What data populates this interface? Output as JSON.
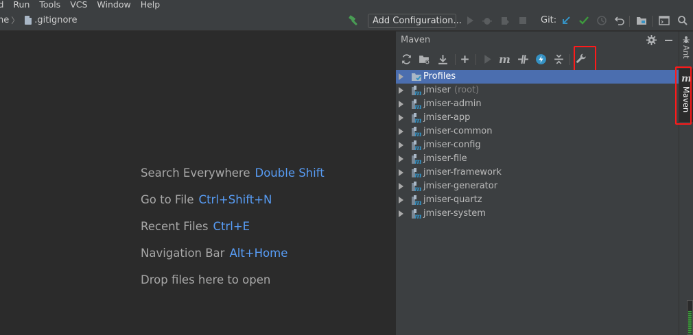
{
  "menu": {
    "items": [
      "ld",
      "Run",
      "Tools",
      "VCS",
      "Window",
      "Help"
    ]
  },
  "breadcrumb": {
    "parent": "ne",
    "file": ".gitignore"
  },
  "toolbar": {
    "add_configuration": "Add Configuration...",
    "git_label": "Git:"
  },
  "editor": {
    "hints": [
      {
        "text": "Search Everywhere",
        "key": "Double Shift"
      },
      {
        "text": "Go to File",
        "key": "Ctrl+Shift+N"
      },
      {
        "text": "Recent Files",
        "key": "Ctrl+E"
      },
      {
        "text": "Navigation Bar",
        "key": "Alt+Home"
      },
      {
        "text": "Drop files here to open",
        "key": ""
      }
    ]
  },
  "maven": {
    "title": "Maven",
    "tree": [
      {
        "label": "Profiles",
        "note": "",
        "icon": "profiles-icon",
        "selected": true
      },
      {
        "label": "jmiser",
        "note": "(root)",
        "icon": "maven-module-icon",
        "selected": false
      },
      {
        "label": "jmiser-admin",
        "note": "",
        "icon": "maven-module-icon",
        "selected": false
      },
      {
        "label": "jmiser-app",
        "note": "",
        "icon": "maven-module-icon",
        "selected": false
      },
      {
        "label": "jmiser-common",
        "note": "",
        "icon": "maven-module-icon",
        "selected": false
      },
      {
        "label": "jmiser-config",
        "note": "",
        "icon": "maven-module-icon",
        "selected": false
      },
      {
        "label": "jmiser-file",
        "note": "",
        "icon": "maven-module-icon",
        "selected": false
      },
      {
        "label": "jmiser-framework",
        "note": "",
        "icon": "maven-module-icon",
        "selected": false
      },
      {
        "label": "jmiser-generator",
        "note": "",
        "icon": "maven-module-icon",
        "selected": false
      },
      {
        "label": "jmiser-quartz",
        "note": "",
        "icon": "maven-module-icon",
        "selected": false
      },
      {
        "label": "jmiser-system",
        "note": "",
        "icon": "maven-module-icon",
        "selected": false
      }
    ]
  },
  "stripe": {
    "ant": "Ant",
    "maven": "Maven"
  },
  "colors": {
    "accent_blue": "#589df6",
    "selection": "#4b6eaf",
    "highlight_red": "#ff1a1a",
    "git_check": "#3d9b3d",
    "git_update": "#3592c4"
  }
}
